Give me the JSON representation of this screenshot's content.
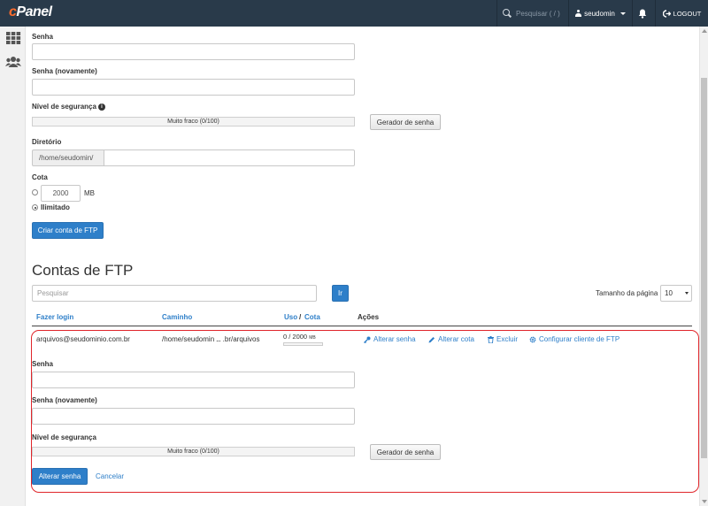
{
  "topbar": {
    "logo": "cPanel",
    "search_placeholder": "Pesquisar ( / )",
    "username": "seudomin",
    "logout": "LOGOUT"
  },
  "form": {
    "password_label": "Senha",
    "password_again_label": "Senha (novamente)",
    "strength_label": "Nível de segurança",
    "strength_value": "Muito fraco (0/100)",
    "generator_button": "Gerador de senha",
    "directory_label": "Diretório",
    "directory_prefix": "/home/seudomin/",
    "quota_label": "Cota",
    "quota_value": "2000",
    "quota_unit": "MB",
    "unlimited_label": "Ilimitado",
    "create_button": "Criar conta de FTP"
  },
  "accounts": {
    "title": "Contas de FTP",
    "search_placeholder": "Pesquisar",
    "go_button": "Ir",
    "page_size_label": "Tamanho da página",
    "page_size_value": "10",
    "columns": {
      "login": "Fazer login",
      "path": "Caminho",
      "usage": "Uso",
      "slash": "/",
      "quota": "Cota",
      "actions": "Ações"
    },
    "row": {
      "login": "arquivos@seudominio.com.br",
      "path_start": "/home/seudomin",
      "path_ellipsis": "...",
      "path_end": ".br/arquivos",
      "usage": "0 / 2000",
      "usage_unit": "MB",
      "usage_fraction": 0,
      "actions": {
        "change_password": "Alterar senha",
        "change_quota": "Alterar cota",
        "delete": "Excluir",
        "configure_client": "Configurar cliente de FTP"
      }
    },
    "edit": {
      "password_label": "Senha",
      "password_again_label": "Senha (novamente)",
      "strength_label": "Nível de segurança",
      "strength_value": "Muito fraco (0/100)",
      "generator_button": "Gerador de senha",
      "submit_button": "Alterar senha",
      "cancel_link": "Cancelar"
    }
  },
  "colors": {
    "topbar": "#293a4a",
    "primary": "#2e7fc9",
    "highlight_border": "#e0262b",
    "logo_accent": "#ff6c2c"
  }
}
